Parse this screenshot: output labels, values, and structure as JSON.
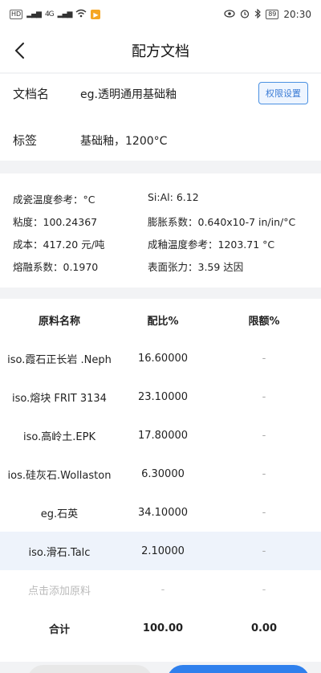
{
  "status": {
    "hd": "HD",
    "network": "4G",
    "wifi": "WiFi",
    "battery": "89",
    "time": "20:30"
  },
  "header": {
    "title": "配方文档"
  },
  "doc": {
    "name_label": "文档名",
    "name_value": "eg.透明通用基础釉",
    "permission_button": "权限设置",
    "tag_label": "标签",
    "tag_value": "基础釉，1200°C"
  },
  "params": {
    "firing_temp": "成瓷温度参考：°C",
    "si_al": "Si:Al:  6.12",
    "viscosity": "粘度：100.24367",
    "expansion": "膨胀系数：0.640x10-7 in/in/°C",
    "cost": "成本：417.20 元/吨",
    "glaze_temp": "成釉温度参考：1203.71 °C",
    "melt": "熔融系数：0.1970",
    "surface_tension": "表面张力：3.59 达因"
  },
  "table": {
    "headers": [
      "原料名称",
      "配比%",
      "限额%"
    ],
    "rows": [
      [
        "iso.霞石正长岩 .Neph",
        "16.60000",
        "-"
      ],
      [
        "iso.熔块 FRIT 3134",
        "23.10000",
        "-"
      ],
      [
        "iso.高岭土.EPK",
        "17.80000",
        "-"
      ],
      [
        "ios.硅灰石.Wollaston",
        "6.30000",
        "-"
      ],
      [
        "eg.石英",
        "34.10000",
        "-"
      ],
      [
        "iso.滑石.Talc",
        "2.10000",
        "-"
      ]
    ],
    "add_row": [
      "点击添加原料",
      "-",
      "-"
    ],
    "total": [
      "合计",
      "100.00",
      "0.00"
    ]
  }
}
